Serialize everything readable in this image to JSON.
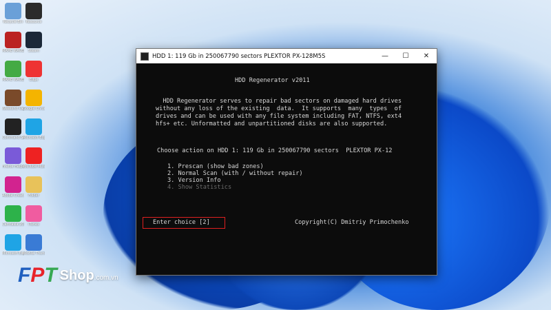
{
  "desktop": {
    "icons": [
      {
        "label": "Recycle Bin",
        "icon": "recycle-bin-icon",
        "color": "#6aa0d8"
      },
      {
        "label": "Resource",
        "icon": "folder-icon",
        "color": "#2b2b2b"
      },
      {
        "label": "MAME WAVES ...",
        "icon": "game-icon",
        "color": "#b22"
      },
      {
        "label": "Steam",
        "icon": "steam-icon",
        "color": "#1b2838"
      },
      {
        "label": "MAME WAVES 5...",
        "icon": "game-icon",
        "color": "#4a4"
      },
      {
        "label": "Edge",
        "icon": "chrome-icon",
        "color": "#e33"
      },
      {
        "label": "Weekend Vagabond",
        "icon": "game-icon",
        "color": "#7a4a2a"
      },
      {
        "label": "Google Chrome",
        "icon": "chrome-icon",
        "color": "#f4b400"
      },
      {
        "label": "Command Shell",
        "icon": "terminal-icon",
        "color": "#222"
      },
      {
        "label": "Microsoft Edge",
        "icon": "edge-icon",
        "color": "#1fa4e5"
      },
      {
        "label": "Firefox Helper",
        "icon": "app-icon",
        "color": "#7a5ad8"
      },
      {
        "label": "YouTube Music",
        "icon": "youtube-icon",
        "color": "#e22"
      },
      {
        "label": "Adobe Creati...",
        "icon": "adobe-icon",
        "color": "#d2238f"
      },
      {
        "label": "Folder",
        "icon": "folder-icon",
        "color": "#e8c25a"
      },
      {
        "label": "Camtasia 2020",
        "icon": "camtasia-icon",
        "color": "#2db24a"
      },
      {
        "label": "iTunes",
        "icon": "itunes-icon",
        "color": "#f05ca0"
      },
      {
        "label": "Microsoft Edge",
        "icon": "edge-icon",
        "color": "#1fa4e5"
      },
      {
        "label": "Mozilla Thunderbird",
        "icon": "thunderbird-icon",
        "color": "#3a7bd5"
      }
    ]
  },
  "window": {
    "title": "HDD 1: 119 Gb in 250067790 sectors  PLEXTOR PX-128M5S",
    "minimize": "—",
    "maximize": "☐",
    "close": "✕"
  },
  "terminal": {
    "heading": "HDD Regenerator v2011",
    "description": [
      "  HDD Regenerator serves to repair bad sectors on damaged hard drives",
      "without any loss of the existing  data.  It supports  many  types  of",
      "drives and can be used with any file system including FAT, NTFS, ext4",
      "hfs+ etc. Unformatted and unpartitioned disks are also supported."
    ],
    "prompt": "Choose action on HDD 1: 119 Gb in 250067790 sectors  PLEXTOR PX-12",
    "menu": [
      "1. Prescan (show bad zones)",
      "2. Normal Scan (with / without repair)",
      "3. Version Info",
      "4. Show Statistics"
    ],
    "choice": "Enter choice [2]",
    "copyright": "Copyright(C) Dmitriy Primochenko"
  },
  "watermark": {
    "brand_letters": [
      "F",
      "P",
      "T"
    ],
    "brand_colors": [
      "#1f5fbf",
      "#e8232a",
      "#36a852"
    ],
    "shop": "Shop",
    "domain": ".com.vn"
  }
}
